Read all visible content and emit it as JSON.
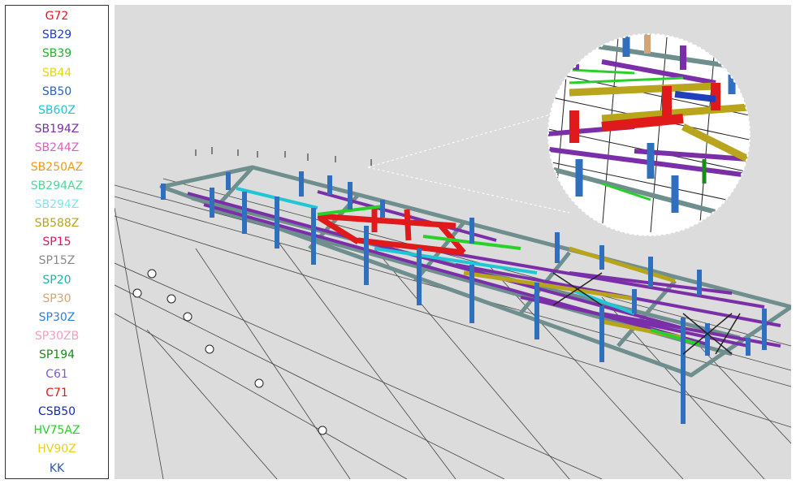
{
  "legend": {
    "items": [
      {
        "label": "G72",
        "color": "#e8141e"
      },
      {
        "label": "SB29",
        "color": "#1f3fbf"
      },
      {
        "label": "SB39",
        "color": "#22b22a"
      },
      {
        "label": "SB44",
        "color": "#e6d41a"
      },
      {
        "label": "SB50",
        "color": "#2a63b8"
      },
      {
        "label": "SB60Z",
        "color": "#1fc6d6"
      },
      {
        "label": "SB194Z",
        "color": "#7a2fa8"
      },
      {
        "label": "SB244Z",
        "color": "#d860c4"
      },
      {
        "label": "SB250AZ",
        "color": "#f09a1a"
      },
      {
        "label": "SB294AZ",
        "color": "#4ed99a"
      },
      {
        "label": "SB294Z",
        "color": "#86e2f2"
      },
      {
        "label": "SB588Z",
        "color": "#b8a51c"
      },
      {
        "label": "SP15",
        "color": "#d91a5a"
      },
      {
        "label": "SP15Z",
        "color": "#8a8a8a"
      },
      {
        "label": "SP20",
        "color": "#16b8b0"
      },
      {
        "label": "SP30",
        "color": "#d2a47a"
      },
      {
        "label": "SP30Z",
        "color": "#2f7fd6"
      },
      {
        "label": "SP30ZB",
        "color": "#f2a0b8"
      },
      {
        "label": "SP194",
        "color": "#1a8a1a"
      },
      {
        "label": "C61",
        "color": "#7a5ad2"
      },
      {
        "label": "C71",
        "color": "#e01a1a"
      },
      {
        "label": "CSB50",
        "color": "#1a2ab8"
      },
      {
        "label": "HV75AZ",
        "color": "#2ad02a"
      },
      {
        "label": "HV90Z",
        "color": "#e8d21a"
      },
      {
        "label": "KK",
        "color": "#2a5aa8"
      }
    ]
  },
  "viewport": {
    "background": "#dcdcdc",
    "frame_color": "#7e9a9a",
    "column_color": "#2f6fbd",
    "icon": "3d-structure-model"
  }
}
